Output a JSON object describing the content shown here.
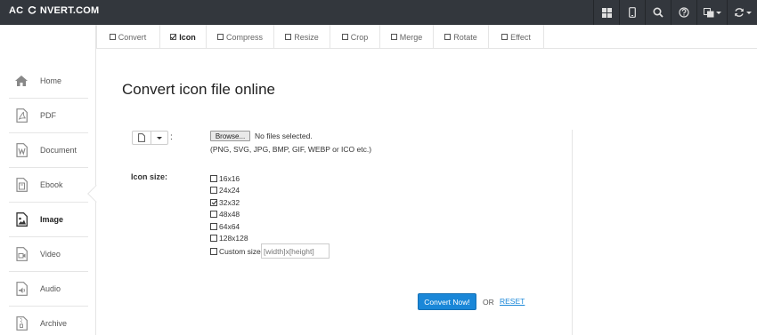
{
  "header": {
    "logo_left": "AC",
    "logo_right": "NVERT.COM",
    "icons": [
      "grid-icon",
      "mobile-icon",
      "search-icon",
      "help-icon",
      "language-icon",
      "refresh-icon"
    ]
  },
  "tabs": [
    {
      "label": "Convert",
      "active": false
    },
    {
      "label": "Icon",
      "active": true
    },
    {
      "label": "Compress",
      "active": false
    },
    {
      "label": "Resize",
      "active": false
    },
    {
      "label": "Crop",
      "active": false
    },
    {
      "label": "Merge",
      "active": false
    },
    {
      "label": "Rotate",
      "active": false
    },
    {
      "label": "Effect",
      "active": false
    }
  ],
  "sidebar": {
    "items": [
      {
        "label": "Home",
        "icon": "home-icon"
      },
      {
        "label": "PDF",
        "icon": "pdf-icon"
      },
      {
        "label": "Document",
        "icon": "document-icon"
      },
      {
        "label": "Ebook",
        "icon": "ebook-icon"
      },
      {
        "label": "Image",
        "icon": "image-icon",
        "active": true
      },
      {
        "label": "Video",
        "icon": "video-icon"
      },
      {
        "label": "Audio",
        "icon": "audio-icon"
      },
      {
        "label": "Archive",
        "icon": "archive-icon"
      }
    ]
  },
  "main": {
    "title": "Convert icon file online",
    "colon": ":",
    "browse_label": "Browse...",
    "no_file_text": "No files selected.",
    "formats_text": "(PNG, SVG, JPG, BMP, GIF, WEBP or ICO etc.)",
    "icon_size_label": "Icon size:",
    "size_options": [
      {
        "label": "16x16",
        "checked": false
      },
      {
        "label": "24x24",
        "checked": false
      },
      {
        "label": "32x32",
        "checked": true
      },
      {
        "label": "48x48",
        "checked": false
      },
      {
        "label": "64x64",
        "checked": false
      },
      {
        "label": "128x128",
        "checked": false
      }
    ],
    "custom_size_label": "Custom size:",
    "custom_size_placeholder": "[width]x[height]",
    "convert_button": "Convert Now!",
    "or_text": "OR",
    "reset_text": "RESET"
  },
  "colors": {
    "topbar": "#33373d",
    "accent": "#1a87d8"
  }
}
